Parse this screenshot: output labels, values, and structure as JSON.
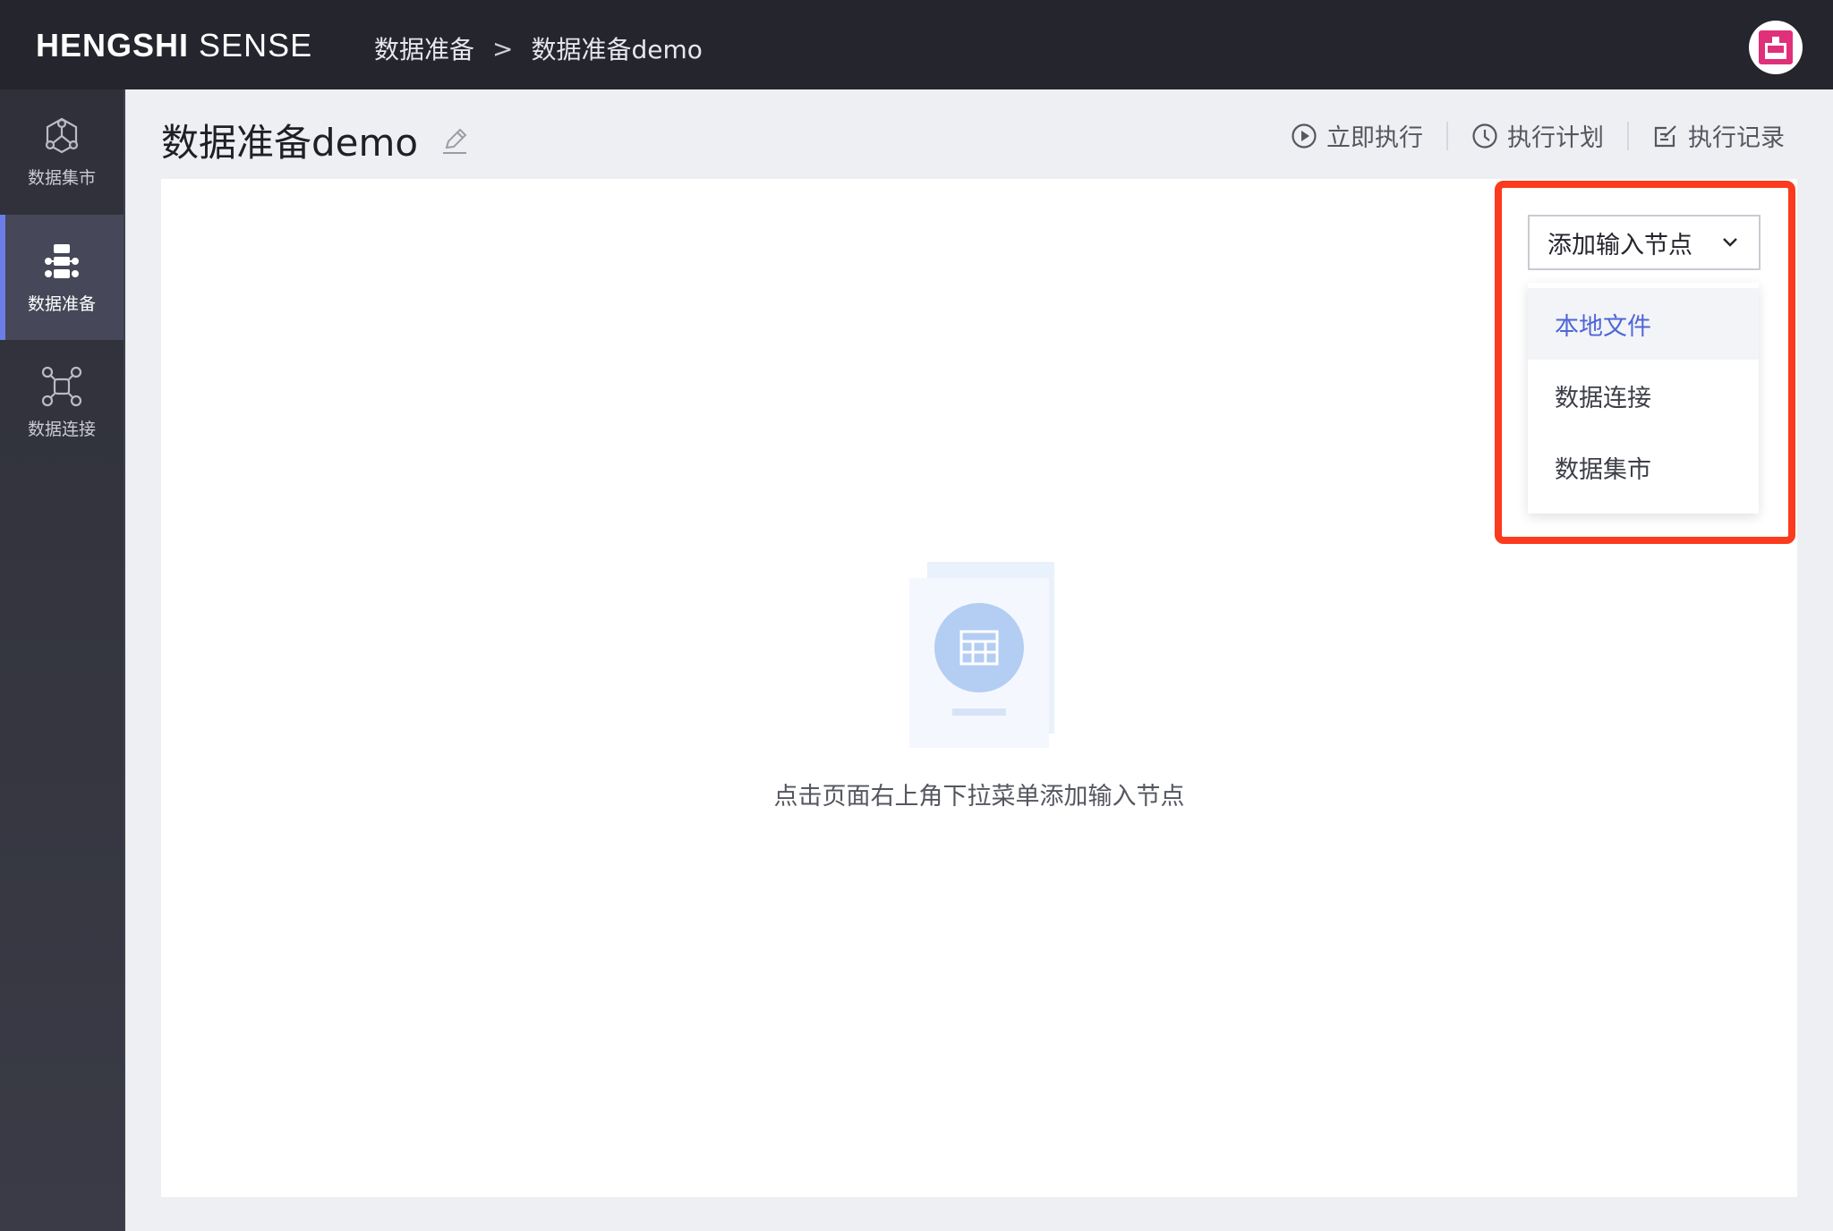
{
  "app": {
    "brand_bold": "HENGSHI",
    "brand_light": "SENSE"
  },
  "breadcrumb": {
    "root": "数据准备",
    "sep": ">",
    "current": "数据准备demo"
  },
  "sidebar": {
    "items": [
      {
        "label": "数据集市",
        "icon": "data-mart-icon"
      },
      {
        "label": "数据准备",
        "icon": "data-prep-icon",
        "active": true
      },
      {
        "label": "数据连接",
        "icon": "data-connection-icon"
      }
    ]
  },
  "page": {
    "title": "数据准备demo"
  },
  "toolbar": {
    "run_now": "立即执行",
    "schedule": "执行计划",
    "records": "执行记录"
  },
  "dropdown": {
    "label": "添加输入节点",
    "options": [
      "本地文件",
      "数据连接",
      "数据集市"
    ],
    "hovered_index": 0
  },
  "empty_state": {
    "message": "点击页面右上角下拉菜单添加输入节点"
  },
  "colors": {
    "highlight": "#fb3a1e",
    "accent": "#4f66d8",
    "active_bar": "#6b7de6",
    "avatar": "#e0307a"
  }
}
